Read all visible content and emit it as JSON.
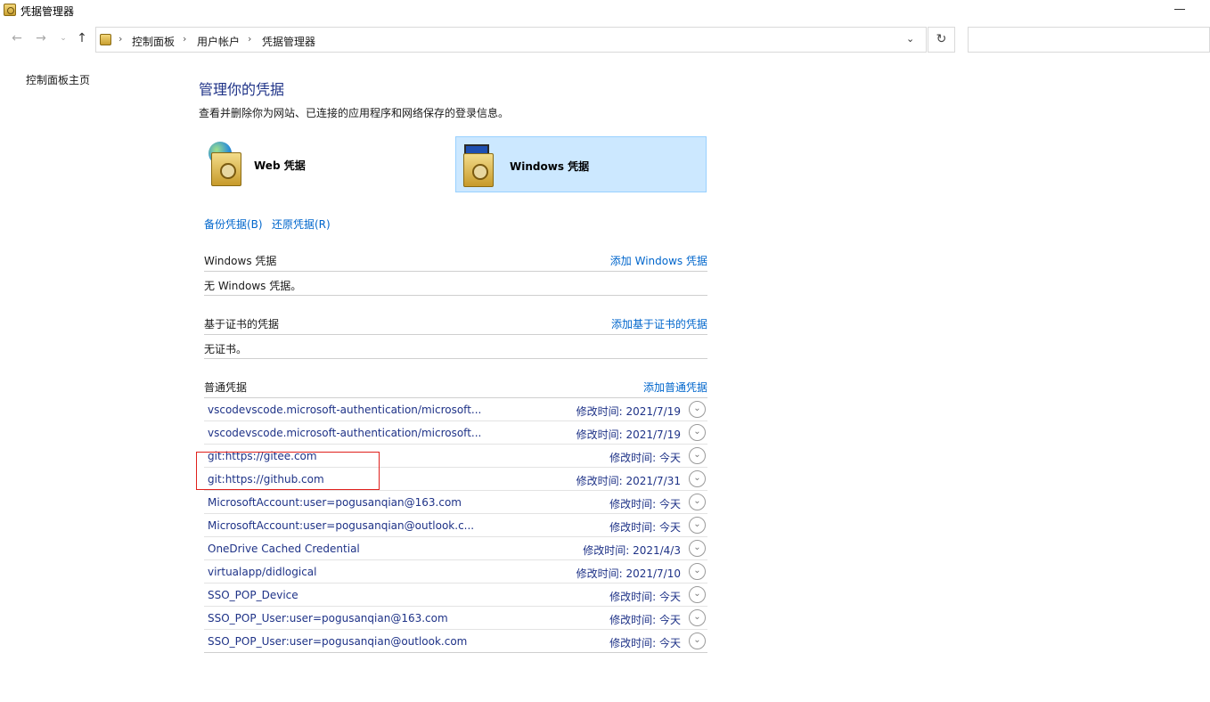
{
  "window": {
    "title": "凭据管理器"
  },
  "address": {
    "crumbs": [
      "控制面板",
      "用户帐户",
      "凭据管理器"
    ]
  },
  "sidebar": {
    "home_link": "控制面板主页"
  },
  "main": {
    "title": "管理你的凭据",
    "description": "查看并删除你为网站、已连接的应用程序和网络保存的登录信息。",
    "types": [
      {
        "label": "Web 凭据",
        "selected": false,
        "icon": "web-credential-icon"
      },
      {
        "label": "Windows 凭据",
        "selected": true,
        "icon": "windows-credential-icon"
      }
    ],
    "backup_link": "备份凭据(B)",
    "restore_link": "还原凭据(R)",
    "windows_section": {
      "title": "Windows 凭据",
      "add_link": "添加 Windows 凭据",
      "empty_text": "无 Windows 凭据。"
    },
    "cert_section": {
      "title": "基于证书的凭据",
      "add_link": "添加基于证书的凭据",
      "empty_text": "无证书。"
    },
    "generic_section": {
      "title": "普通凭据",
      "add_link": "添加普通凭据",
      "items": [
        {
          "name": "vscodevscode.microsoft-authentication/microsoft...",
          "modified": "修改时间:  2021/7/19"
        },
        {
          "name": "vscodevscode.microsoft-authentication/microsoft...",
          "modified": "修改时间:  2021/7/19"
        },
        {
          "name": "git:https://gitee.com",
          "modified": "修改时间:  今天"
        },
        {
          "name": "git:https://github.com",
          "modified": "修改时间:  2021/7/31"
        },
        {
          "name": "MicrosoftAccount:user=pogusanqian@163.com",
          "modified": "修改时间:  今天"
        },
        {
          "name": "MicrosoftAccount:user=pogusanqian@outlook.c...",
          "modified": "修改时间:  今天"
        },
        {
          "name": "OneDrive Cached Credential",
          "modified": "修改时间:  2021/4/3"
        },
        {
          "name": "virtualapp/didlogical",
          "modified": "修改时间:  2021/7/10"
        },
        {
          "name": "SSO_POP_Device",
          "modified": "修改时间:  今天"
        },
        {
          "name": "SSO_POP_User:user=pogusanqian@163.com",
          "modified": "修改时间:  今天"
        },
        {
          "name": "SSO_POP_User:user=pogusanqian@outlook.com",
          "modified": "修改时间:  今天"
        }
      ]
    }
  },
  "colors": {
    "link": "#0066cc",
    "heading": "#1e3287",
    "selected_bg": "#cce8ff",
    "highlight": "#e0201c"
  }
}
